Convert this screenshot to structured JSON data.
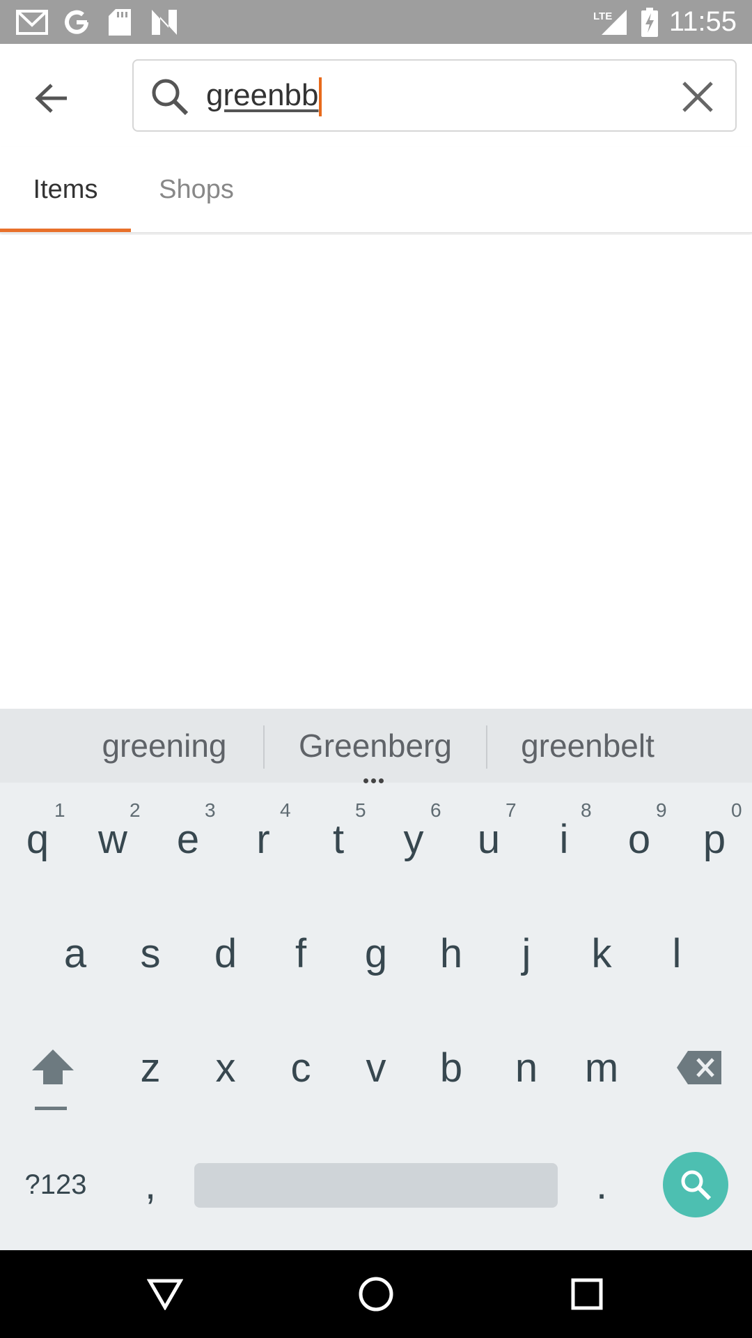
{
  "status_bar": {
    "time": "11:55",
    "network": "LTE",
    "icons": [
      "gmail-icon",
      "google-icon",
      "sd-card-icon",
      "n-icon",
      "signal-icon",
      "battery-charging-icon"
    ]
  },
  "header": {
    "search_query": "greenbb"
  },
  "tabs": [
    {
      "label": "Items",
      "selected": true
    },
    {
      "label": "Shops",
      "selected": false
    }
  ],
  "keyboard": {
    "suggestions": [
      "greening",
      "Greenberg",
      "greenbelt"
    ],
    "row1": [
      {
        "key": "q",
        "hint": "1"
      },
      {
        "key": "w",
        "hint": "2"
      },
      {
        "key": "e",
        "hint": "3"
      },
      {
        "key": "r",
        "hint": "4"
      },
      {
        "key": "t",
        "hint": "5"
      },
      {
        "key": "y",
        "hint": "6"
      },
      {
        "key": "u",
        "hint": "7"
      },
      {
        "key": "i",
        "hint": "8"
      },
      {
        "key": "o",
        "hint": "9"
      },
      {
        "key": "p",
        "hint": "0"
      }
    ],
    "row2": [
      "a",
      "s",
      "d",
      "f",
      "g",
      "h",
      "j",
      "k",
      "l"
    ],
    "row3": [
      "z",
      "x",
      "c",
      "v",
      "b",
      "n",
      "m"
    ],
    "symbols_label": "?123",
    "comma": ",",
    "period": "."
  },
  "colors": {
    "accent": "#e8702a",
    "status_bar": "#9e9e9e",
    "keyboard_bg": "#eceff1",
    "search_key": "#4dbfb1"
  }
}
